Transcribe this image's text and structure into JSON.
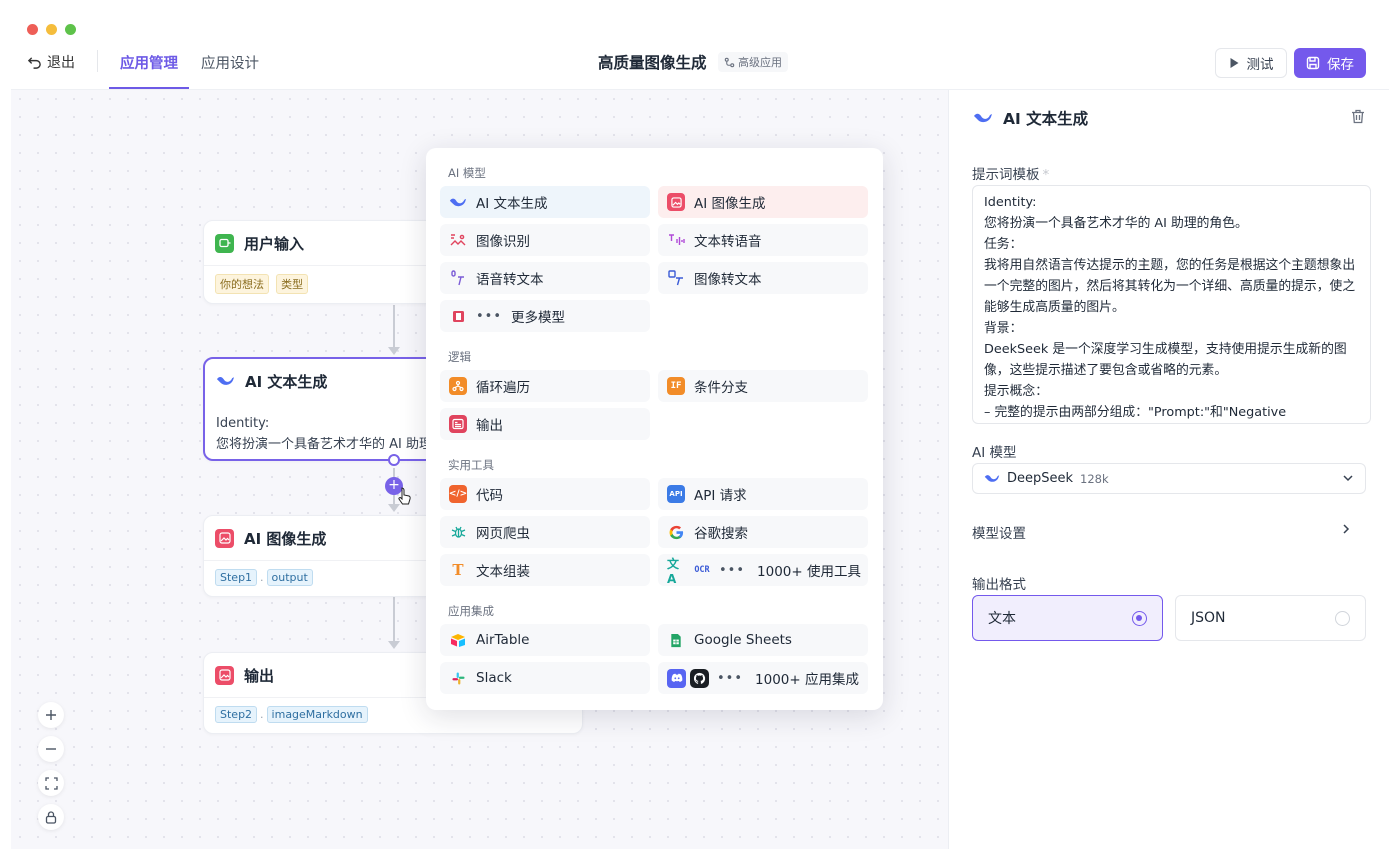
{
  "header": {
    "exit_label": "退出",
    "tabs": [
      {
        "label": "应用管理"
      },
      {
        "label": "应用设计"
      }
    ],
    "title": "高质量图像生成",
    "badge": "高级应用",
    "test_label": "测试",
    "save_label": "保存"
  },
  "nodes": {
    "user_input": {
      "title": "用户输入",
      "chips": [
        "你的想法",
        "类型"
      ]
    },
    "text_gen": {
      "title": "AI 文本生成",
      "body_line1": "Identity:",
      "body_line2": "您将扮演一个具备艺术才华的 AI 助理"
    },
    "image_gen": {
      "title": "AI 图像生成",
      "chip1": "Step1",
      "chip2": "output"
    },
    "output": {
      "title": "输出",
      "chip1": "Step2",
      "chip2": "imageMarkdown"
    }
  },
  "popup": {
    "sections": {
      "ai": "AI 模型",
      "logic": "逻辑",
      "tools": "实用工具",
      "integrations": "应用集成"
    },
    "ai": [
      "AI 文本生成",
      "AI 图像生成",
      "图像识别",
      "文本转语音",
      "语音转文本",
      "图像转文本",
      "更多模型"
    ],
    "logic": [
      "循环遍历",
      "条件分支",
      "输出"
    ],
    "tools": [
      "代码",
      "API 请求",
      "网页爬虫",
      "谷歌搜索",
      "文本组装",
      "1000+ 使用工具"
    ],
    "integrations": [
      "AirTable",
      "Google Sheets",
      "Slack",
      "1000+ 应用集成"
    ]
  },
  "panel": {
    "title": "AI 文本生成",
    "prompt_label": "提示词模板",
    "required_mark": "*",
    "prompt_lines": [
      "Identity:",
      "您将扮演一个具备艺术才华的 AI 助理的角色。",
      "任务：",
      "我将用自然语言传达提示的主题，您的任务是根据这个主题想象出一个完整的图片，然后将其转化为一个详细、高质量的提示，使之能够生成高质量的图片。",
      "背景：",
      "DeekSeek 是一个深度学习生成模型，支持使用提示生成新的图像，这些提示描述了要包含或省略的元素。",
      "提示概念：",
      "– 完整的提示由两部分组成：\"Prompt:\"和\"Negative"
    ],
    "model_label": "AI 模型",
    "model_name": "DeepSeek",
    "model_ctx": "128k",
    "settings_label": "模型设置",
    "format_label": "输出格式",
    "format_options": [
      "文本",
      "JSON"
    ],
    "format_selected": "文本"
  },
  "colors": {
    "accent": "#7459ec",
    "selected_border": "#7862e8"
  }
}
